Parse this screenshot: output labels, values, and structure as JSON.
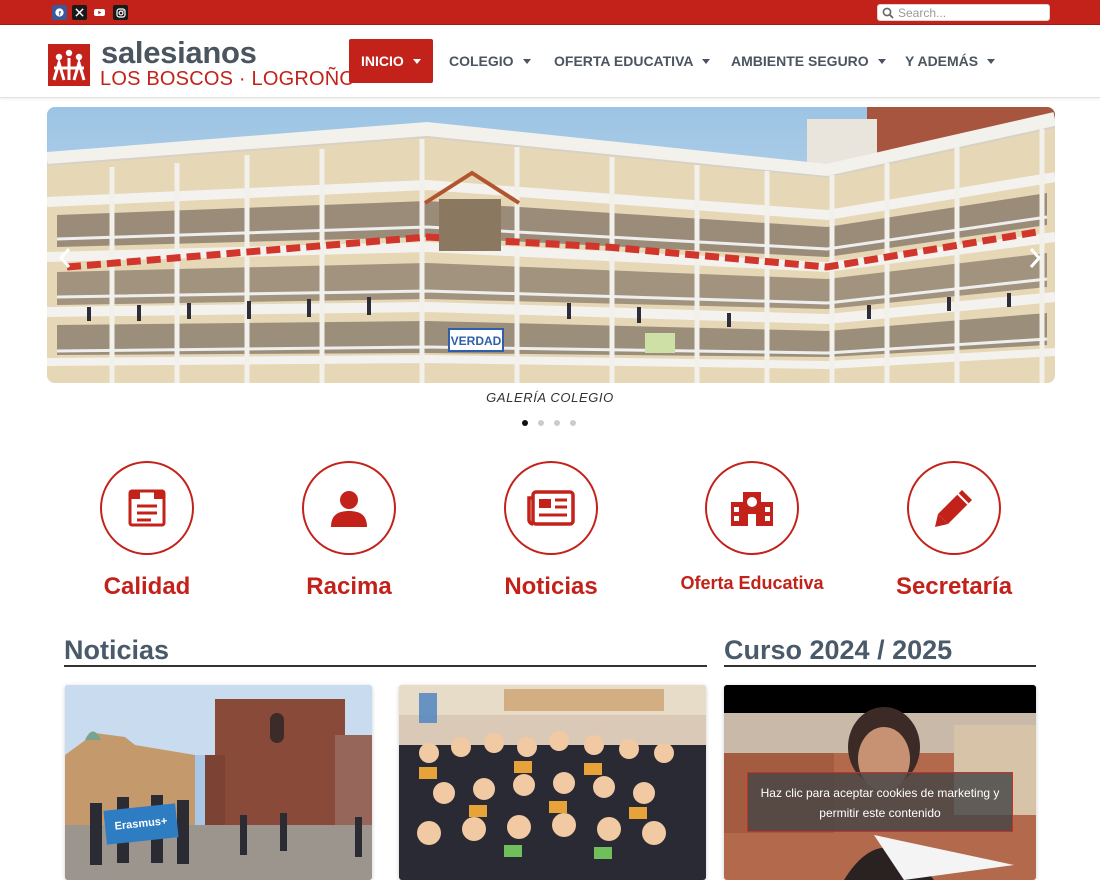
{
  "topbar": {
    "search_placeholder": "Search...",
    "social": [
      "facebook-icon",
      "x-icon",
      "youtube-icon",
      "instagram-icon"
    ]
  },
  "brand": {
    "name": "salesianos",
    "subtitle": "LOS BOSCOS · LOGROÑO",
    "colors": {
      "primary": "#c3221a",
      "text": "#4a5560"
    }
  },
  "nav": {
    "items": [
      {
        "label": "INICIO",
        "active": true
      },
      {
        "label": "COLEGIO",
        "active": false
      },
      {
        "label": "OFERTA EDUCATIVA",
        "active": false
      },
      {
        "label": "AMBIENTE SEGURO",
        "active": false
      },
      {
        "label": "Y ADEMÁS",
        "active": false
      }
    ]
  },
  "slider": {
    "caption": "GALERÍA COLEGIO",
    "banner_text": "VERDAD",
    "slide_count": 4,
    "active_index": 0
  },
  "shortcuts": [
    {
      "label": "Calidad",
      "icon": "certificate-icon"
    },
    {
      "label": "Racima",
      "icon": "user-icon"
    },
    {
      "label": "Noticias",
      "icon": "newspaper-icon"
    },
    {
      "label": "Oferta Educativa",
      "icon": "school-icon"
    },
    {
      "label": "Secretaría",
      "icon": "pencil-icon"
    }
  ],
  "news": {
    "title": "Noticias",
    "cards": [
      {
        "banner": "Erasmus+"
      },
      {
        "banner": ""
      }
    ]
  },
  "course": {
    "title": "Curso 2024 / 2025",
    "cookie_notice": "Haz clic para aceptar cookies de marketing y permitir este contenido"
  }
}
